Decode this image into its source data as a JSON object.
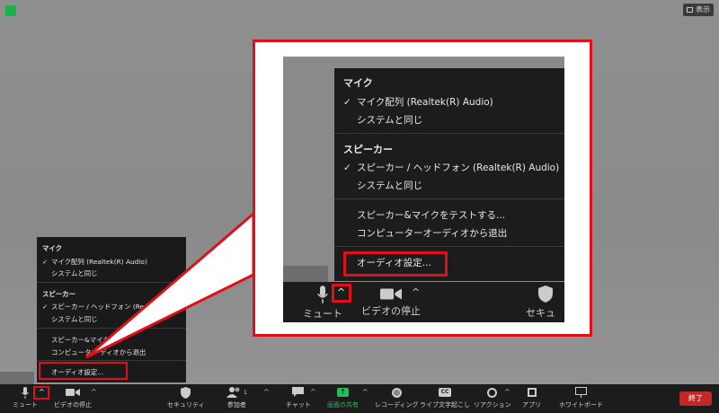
{
  "top_right": {
    "view_label": "表示"
  },
  "audio_menu": {
    "mic_header": "マイク",
    "mic_items": [
      {
        "label": "マイク配列 (Realtek(R) Audio)",
        "checked": true
      },
      {
        "label": "システムと同じ",
        "checked": false
      }
    ],
    "speaker_header": "スピーカー",
    "speaker_items_zoom": [
      {
        "label": "スピーカー / ヘッドフォン (Realtek(R) Audio)",
        "checked": true
      },
      {
        "label": "システムと同じ",
        "checked": false
      }
    ],
    "speaker_items_small": [
      {
        "label": "スピーカー / ヘッドフォン (Realtek",
        "checked": true
      },
      {
        "label": "システムと同じ",
        "checked": false
      }
    ],
    "test_label": "スピーカー&マイクをテストする...",
    "test_label_small": "スピーカー&マイクを",
    "leave_label": "コンピューターオーディオから退出",
    "leave_label_small": "コンピューター    ディオから退出",
    "settings_label": "オーディオ設定..."
  },
  "toolbar": {
    "mute": "ミュート",
    "video": "ビデオの停止",
    "security": "セキュリティ",
    "participants": "参加者",
    "participants_count": "1",
    "chat": "チャット",
    "share": "画面の共有",
    "record": "レコーディング",
    "captions": "ライブ文字起こし",
    "reactions": "リアクション",
    "apps": "アプリ",
    "whiteboard": "ホワイトボード",
    "end": "終了",
    "cc_badge": "CC"
  },
  "colors": {
    "accent_red": "#e0101a",
    "share_green": "#1fbf5a",
    "end_red": "#c2282a"
  }
}
